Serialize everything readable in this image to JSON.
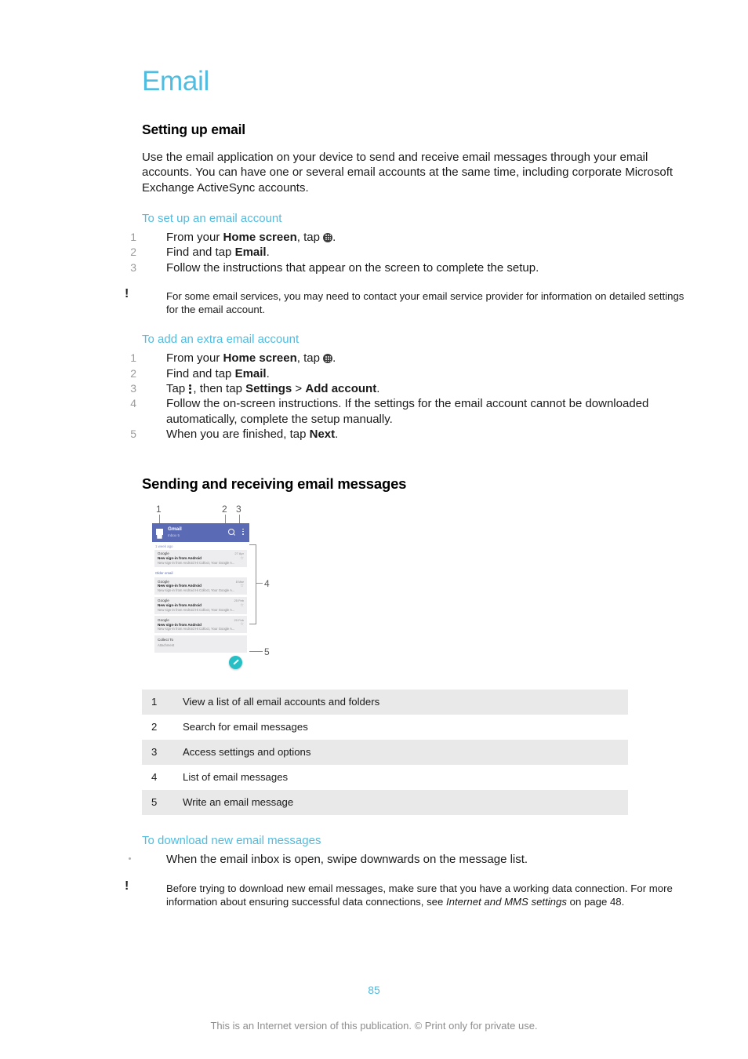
{
  "chapter": {
    "title": "Email"
  },
  "sections": {
    "setting_up": {
      "heading": "Setting up email",
      "intro": "Use the email application on your device to send and receive email messages through your email accounts. You can have one or several email accounts at the same time, including corporate Microsoft Exchange ActiveSync accounts."
    },
    "sending_receiving": {
      "heading": "Sending and receiving email messages"
    }
  },
  "procedures": {
    "setup_account": {
      "heading": "To set up an email account",
      "steps": [
        {
          "num": "1",
          "prefix": "From your ",
          "bold": "Home screen",
          "mid": ", tap ",
          "icon": "app-drawer-icon",
          "suffix": "."
        },
        {
          "num": "2",
          "prefix": "Find and tap ",
          "bold": "Email",
          "mid": "",
          "icon": "",
          "suffix": "."
        },
        {
          "num": "3",
          "prefix": "Follow the instructions that appear on the screen to complete the setup.",
          "bold": "",
          "mid": "",
          "icon": "",
          "suffix": ""
        }
      ],
      "note": "For some email services, you may need to contact your email service provider for information on detailed settings for the email account."
    },
    "add_extra_account": {
      "heading": "To add an extra email account",
      "steps": [
        {
          "num": "1",
          "text_a": "From your ",
          "bold_a": "Home screen",
          "text_b": ", tap ",
          "icon": "app-drawer-icon",
          "text_c": "."
        },
        {
          "num": "2",
          "text_a": "Find and tap ",
          "bold_a": "Email",
          "text_b": "",
          "icon": "",
          "text_c": "."
        },
        {
          "num": "3",
          "text_a": "Tap ",
          "icon": "overflow-menu-icon",
          "text_b": ", then tap ",
          "bold_a": "Settings",
          "sep": " > ",
          "bold_b": "Add account",
          "text_c": "."
        },
        {
          "num": "4",
          "text_a": "Follow the on-screen instructions. If the settings for the email account cannot be downloaded automatically, complete the setup manually.",
          "bold_a": "",
          "text_b": "",
          "icon": "",
          "text_c": ""
        },
        {
          "num": "5",
          "text_a": "When you are finished, tap ",
          "bold_a": "Next",
          "text_b": "",
          "icon": "",
          "text_c": "."
        }
      ]
    },
    "download_new": {
      "heading": "To download new email messages",
      "bullet": "When the email inbox is open, swipe downwards on the message list.",
      "note_part1": "Before trying to download new email messages, make sure that you have a working data connection. For more information about ensuring successful data connections, see ",
      "note_italic": "Internet and MMS settings",
      "note_part2": " on page 48."
    }
  },
  "figure": {
    "callouts_top": [
      "1",
      "2",
      "3"
    ],
    "callouts_side": [
      "4",
      "5"
    ],
    "phone": {
      "app_bar": {
        "title": "Gmail",
        "subtitle": "Inbox 5",
        "menu_icon": "hamburger-menu-icon",
        "search_icon": "search-icon",
        "overflow_icon": "overflow-menu-icon"
      },
      "time_label": "1 week ago",
      "divider_label": "Older email",
      "messages": [
        {
          "sender": "Google",
          "subject": "New sign-in from Android",
          "preview": "New sign-in from Android Hi Colloct, Your Google A...",
          "date": "27 Apr"
        },
        {
          "sender": "Google",
          "subject": "New sign-in from Android",
          "preview": "New sign-in from Android Hi Colloct, Your Google A...",
          "date": "8 Mar"
        },
        {
          "sender": "Google",
          "subject": "New sign-in from Android",
          "preview": "New sign-in from Android Hi Colloct, Your Google A...",
          "date": "25 Feb"
        },
        {
          "sender": "Google",
          "subject": "New sign-in from Android",
          "preview": "New sign-in from Android Hi Colloct, Your Google A...",
          "date": "20 Feb"
        }
      ],
      "bottom_row": {
        "sender": "Collect To",
        "subject": "Attachment"
      },
      "compose_fab": "compose-pencil-icon",
      "fab_color": "#27bfc6",
      "app_bar_color": "#5b6ab4"
    }
  },
  "legend": {
    "rows": [
      {
        "index": "1",
        "description": "View a list of all email accounts and folders"
      },
      {
        "index": "2",
        "description": "Search for email messages"
      },
      {
        "index": "3",
        "description": "Access settings and options"
      },
      {
        "index": "4",
        "description": "List of email messages"
      },
      {
        "index": "5",
        "description": "Write an email message"
      }
    ]
  },
  "footer": {
    "page_number": "85",
    "notice": "This is an Internet version of this publication. © Print only for private use."
  },
  "colors": {
    "accent": "#4FBCE0",
    "table_shade": "#e9e9e9",
    "muted": "#8d8d8f"
  }
}
